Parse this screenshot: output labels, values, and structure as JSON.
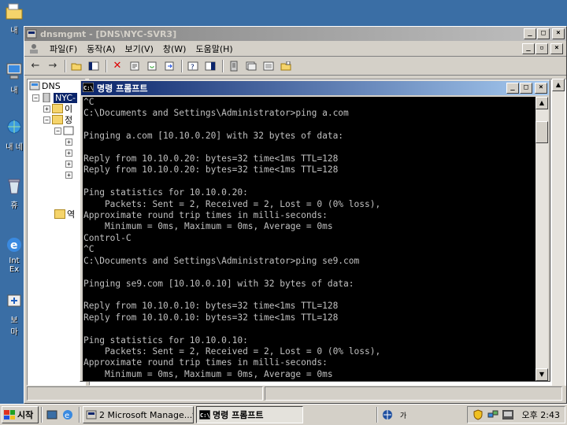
{
  "desktop": {
    "icons": [
      {
        "label": "내",
        "icon": "folder-icon"
      },
      {
        "label": "내",
        "icon": "my-computer-icon"
      },
      {
        "label": "내 네",
        "icon": "network-icon"
      },
      {
        "label": "휴",
        "icon": "recycle-bin-icon"
      },
      {
        "label": "Int",
        "label2": "Ex",
        "icon": "internet-explorer-icon"
      },
      {
        "label": "보",
        "label2": "마",
        "icon": "shortcut-icon"
      }
    ]
  },
  "mmc": {
    "title": "dnsmgmt - [DNS\\NYC-SVR3]",
    "menu": [
      "파일(F)",
      "동작(A)",
      "보기(V)",
      "창(W)",
      "도움말(H)"
    ],
    "tree": {
      "root": "DNS",
      "server": "NYC-",
      "children": [
        "이",
        "정",
        "",
        "",
        "",
        "",
        "역"
      ]
    }
  },
  "cmd": {
    "title": "명령 프롬프트",
    "lines": [
      "^C",
      "C:\\Documents and Settings\\Administrator>ping a.com",
      "",
      "Pinging a.com [10.10.0.20] with 32 bytes of data:",
      "",
      "Reply from 10.10.0.20: bytes=32 time<1ms TTL=128",
      "Reply from 10.10.0.20: bytes=32 time<1ms TTL=128",
      "",
      "Ping statistics for 10.10.0.20:",
      "    Packets: Sent = 2, Received = 2, Lost = 0 (0% loss),",
      "Approximate round trip times in milli-seconds:",
      "    Minimum = 0ms, Maximum = 0ms, Average = 0ms",
      "Control-C",
      "^C",
      "C:\\Documents and Settings\\Administrator>ping se9.com",
      "",
      "Pinging se9.com [10.10.0.10] with 32 bytes of data:",
      "",
      "Reply from 10.10.0.10: bytes=32 time<1ms TTL=128",
      "Reply from 10.10.0.10: bytes=32 time<1ms TTL=128",
      "",
      "Ping statistics for 10.10.0.10:",
      "    Packets: Sent = 2, Received = 2, Lost = 0 (0% loss),",
      "Approximate round trip times in milli-seconds:",
      "    Minimum = 0ms, Maximum = 0ms, Average = 0ms"
    ]
  },
  "taskbar": {
    "start_label": "시작",
    "tasks": [
      {
        "label": "2 Microsoft Manage...",
        "icon": "mmc-icon",
        "active": false
      },
      {
        "label": "명령 프롬프트",
        "icon": "cmd-icon",
        "active": true
      }
    ],
    "clock": "오후 2:43"
  },
  "colors": {
    "desktop": "#3a6ea5",
    "title_active": "#0a246a",
    "console_bg": "#000000",
    "console_fg": "#c0c0c0"
  }
}
